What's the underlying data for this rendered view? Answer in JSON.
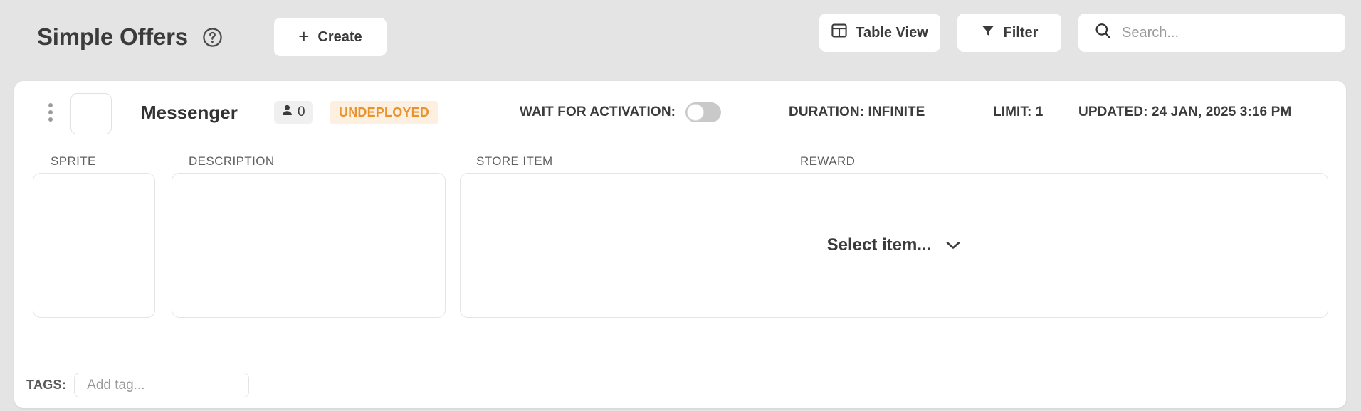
{
  "header": {
    "title": "Simple Offers",
    "help_icon": "question-circle-icon",
    "create_label": "Create",
    "create_plus": "+",
    "table_view_label": "Table View",
    "table_view_icon": "table-grid-icon",
    "filter_label": "Filter",
    "filter_icon": "funnel-icon",
    "search_placeholder": "Search...",
    "search_value": "",
    "search_icon": "magnifier-icon"
  },
  "offer": {
    "drag_handle_icon": "vertical-dots-drag-icon",
    "sprite_thumbnail": "",
    "name": "Messenger",
    "audience_icon": "person-icon",
    "audience_count": "0",
    "status": "UNDEPLOYED",
    "wait_for_activation_label": "WAIT FOR ACTIVATION:",
    "wait_for_activation_on": false,
    "duration": "DURATION: INFINITE",
    "limit": "LIMIT: 1",
    "updated": "UPDATED: 24 JAN, 2025 3:16 PM",
    "columns": {
      "sprite": "SPRITE",
      "description": "DESCRIPTION",
      "store_item": "STORE ITEM",
      "reward": "REWARD"
    },
    "sprite_value": "",
    "description_value": "",
    "store_item_placeholder": "Select item...",
    "store_item_chevron": "chevron-down-icon",
    "tags_label": "TAGS:",
    "tag_placeholder": "Add tag...",
    "tag_value": ""
  },
  "colors": {
    "page_background": "#e4e4e4",
    "card_background": "#ffffff",
    "text_primary": "#3b3b3b",
    "text_muted": "#9a9a9a",
    "status_text": "#e8932e",
    "status_background": "#fdf0e1",
    "border": "#e4e4e4",
    "toggle_off_track": "#c9c9c9"
  }
}
